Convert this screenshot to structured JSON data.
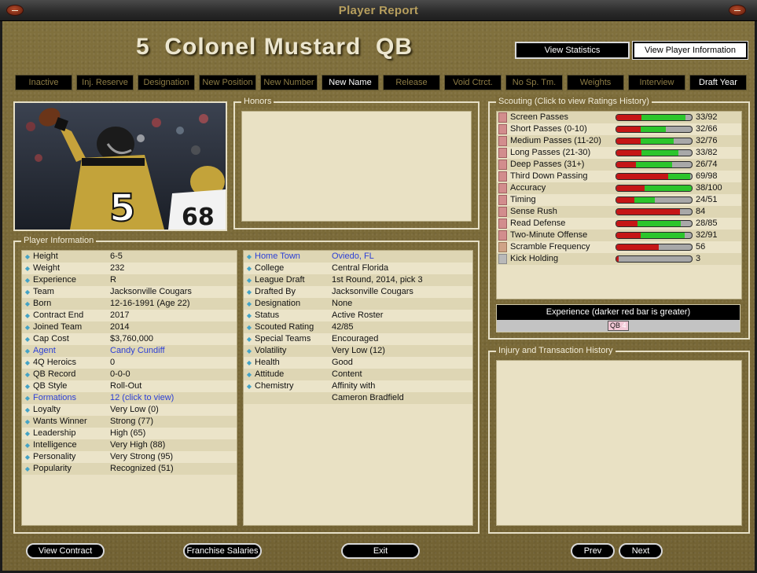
{
  "window": {
    "title": "Player Report"
  },
  "player": {
    "number": "5",
    "name": "Colonel Mustard",
    "position": "QB"
  },
  "view_buttons": {
    "statistics": "View Statistics",
    "player_info": "View Player Information"
  },
  "actions": [
    {
      "label": "Inactive",
      "active": false
    },
    {
      "label": "Inj. Reserve",
      "active": false
    },
    {
      "label": "Designation",
      "active": false
    },
    {
      "label": "New Position",
      "active": false
    },
    {
      "label": "New Number",
      "active": false
    },
    {
      "label": "New Name",
      "active": true
    },
    {
      "label": "Release",
      "active": false
    },
    {
      "label": "Void Ctrct.",
      "active": false
    },
    {
      "label": "No Sp. Tm.",
      "active": false
    },
    {
      "label": "Weights",
      "active": false
    },
    {
      "label": "Interview",
      "active": false
    },
    {
      "label": "Draft Year",
      "active": true
    }
  ],
  "sections": {
    "honors": "Honors",
    "player_info": "Player Information",
    "scouting": "Scouting (Click to view Ratings History)",
    "injury": "Injury and Transaction History"
  },
  "player_info_left": [
    {
      "label": "Height",
      "value": "6-5"
    },
    {
      "label": "Weight",
      "value": "232"
    },
    {
      "label": "Experience",
      "value": "R"
    },
    {
      "label": "Team",
      "value": "Jacksonville Cougars"
    },
    {
      "label": "Born",
      "value": "12-16-1991 (Age 22)"
    },
    {
      "label": "Contract End",
      "value": "2017"
    },
    {
      "label": "Joined Team",
      "value": "2014"
    },
    {
      "label": "Cap Cost",
      "value": "$3,760,000"
    },
    {
      "label": "Agent",
      "value": "Candy Cundiff",
      "link": true
    },
    {
      "label": "4Q Heroics",
      "value": "0"
    },
    {
      "label": "QB Record",
      "value": "0-0-0"
    },
    {
      "label": "QB Style",
      "value": "Roll-Out"
    },
    {
      "label": "Formations",
      "value": "12 (click to view)",
      "link": true
    },
    {
      "label": "Loyalty",
      "value": "Very Low (0)"
    },
    {
      "label": "Wants Winner",
      "value": "Strong (77)"
    },
    {
      "label": "Leadership",
      "value": "High (65)"
    },
    {
      "label": "Intelligence",
      "value": "Very High (88)"
    },
    {
      "label": "Personality",
      "value": "Very Strong (95)"
    },
    {
      "label": "Popularity",
      "value": "Recognized (51)"
    }
  ],
  "player_info_right": [
    {
      "label": "Home Town",
      "value": "Oviedo, FL",
      "link": true
    },
    {
      "label": "College",
      "value": "Central Florida"
    },
    {
      "label": "League Draft",
      "value": "1st Round, 2014, pick 3"
    },
    {
      "label": "Drafted By",
      "value": "Jacksonville Cougars"
    },
    {
      "label": "Designation",
      "value": "None"
    },
    {
      "label": "Status",
      "value": "Active Roster"
    },
    {
      "label": "Scouted Rating",
      "value": "42/85"
    },
    {
      "label": "Special Teams",
      "value": "Encouraged"
    },
    {
      "label": "Volatility",
      "value": "Very Low (12)"
    },
    {
      "label": "Health",
      "value": "Good"
    },
    {
      "label": "Attitude",
      "value": "Content"
    },
    {
      "label": "Chemistry",
      "value": "Affinity with"
    },
    {
      "label": "",
      "value": "Cameron Bradfield",
      "no_bullet": true
    }
  ],
  "scouting": [
    {
      "name": "Screen Passes",
      "current": 33,
      "potential": 92,
      "text": "33/92",
      "swatch": "red"
    },
    {
      "name": "Short Passes (0-10)",
      "current": 32,
      "potential": 66,
      "text": "32/66",
      "swatch": "red"
    },
    {
      "name": "Medium Passes (11-20)",
      "current": 32,
      "potential": 76,
      "text": "32/76",
      "swatch": "red"
    },
    {
      "name": "Long Passes (21-30)",
      "current": 33,
      "potential": 82,
      "text": "33/82",
      "swatch": "red"
    },
    {
      "name": "Deep Passes (31+)",
      "current": 26,
      "potential": 74,
      "text": "26/74",
      "swatch": "red"
    },
    {
      "name": "Third Down Passing",
      "current": 69,
      "potential": 98,
      "text": "69/98",
      "swatch": "red"
    },
    {
      "name": "Accuracy",
      "current": 38,
      "potential": 100,
      "text": "38/100",
      "swatch": "red"
    },
    {
      "name": "Timing",
      "current": 24,
      "potential": 51,
      "text": "24/51",
      "swatch": "red"
    },
    {
      "name": "Sense Rush",
      "current": 84,
      "potential": 84,
      "text": "84",
      "swatch": "red"
    },
    {
      "name": "Read Defense",
      "current": 28,
      "potential": 85,
      "text": "28/85",
      "swatch": "red"
    },
    {
      "name": "Two-Minute Offense",
      "current": 32,
      "potential": 91,
      "text": "32/91",
      "swatch": "red"
    },
    {
      "name": "Scramble Frequency",
      "current": 56,
      "potential": 56,
      "text": "56",
      "swatch": "tan"
    },
    {
      "name": "Kick Holding",
      "current": 3,
      "potential": 3,
      "text": "3",
      "swatch": "gray"
    }
  ],
  "experience": {
    "header": "Experience (darker red bar is greater)",
    "position": "QB",
    "value": "4"
  },
  "bottom_buttons": {
    "view_contract": "View Contract",
    "franchise_salaries": "Franchise Salaries",
    "exit": "Exit",
    "prev": "Prev",
    "next": "Next"
  },
  "colors": {
    "accent_gold": "#b79f5e",
    "panel_bg": "#e9e1c4",
    "link_blue": "#2c3fd6"
  }
}
